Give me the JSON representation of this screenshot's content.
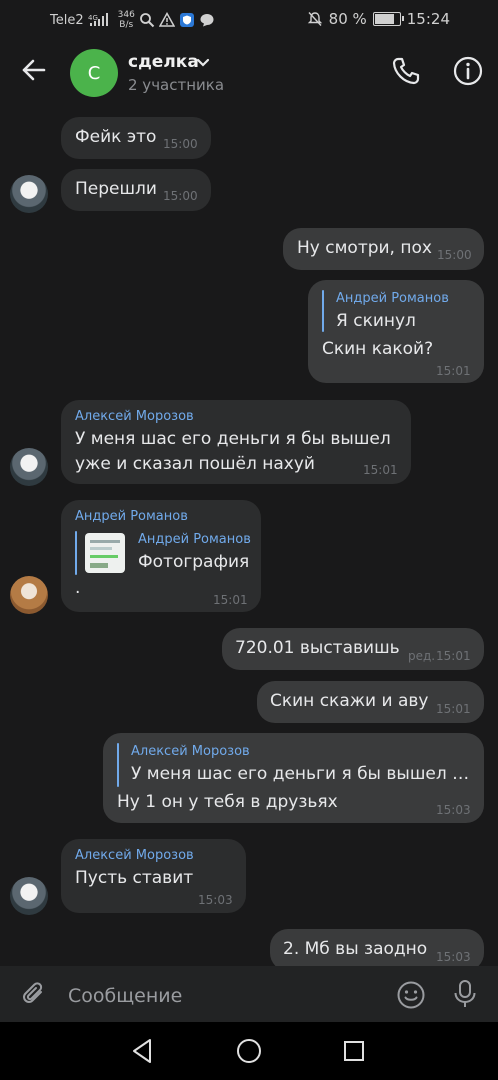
{
  "status_bar": {
    "carrier": "Tele2",
    "network": "4G",
    "speed_value": "346",
    "speed_unit": "B/s",
    "battery": "80 %",
    "battery_level": 0.8,
    "time": "15:24"
  },
  "header": {
    "avatar_letter": "С",
    "title": "сделка",
    "subtitle": "2 участника"
  },
  "messages": [
    {
      "text": "Фейк это",
      "time": "15:00"
    },
    {
      "text": "Перешли",
      "time": "15:00"
    },
    {
      "text": "Ну смотри, пох",
      "time": "15:00"
    },
    {
      "reply_name": "Андрей Романов",
      "reply_text": "Я скинул",
      "text": "Скин какой?",
      "time": "15:01"
    },
    {
      "sender": "Алексей Морозов",
      "line1": "У меня шас его деньги я бы вышел",
      "line2": "уже и сказал пошёл нахуй",
      "time": "15:01"
    },
    {
      "sender": "Андрей Романов",
      "reply_name": "Андрей Романов",
      "reply_text": "Фотография",
      "text": ".",
      "time": "15:01"
    },
    {
      "text": "720.01 выставишь",
      "edited": "ред.",
      "time": "15:01"
    },
    {
      "text": "Скин скажи и аву",
      "time": "15:01"
    },
    {
      "reply_name": "Алексей Морозов",
      "reply_text": "У меня шас его деньги я бы вышел уже и сказал пошёл нахуй",
      "text": "Ну 1 он у тебя в друзьях",
      "time": "15:03"
    },
    {
      "sender": "Алексей Морозов",
      "text": "Пусть ставит",
      "time": "15:03"
    },
    {
      "text": "2. Мб вы заодно",
      "time": "15:03"
    }
  ],
  "composer": {
    "placeholder": "Сообщение"
  },
  "icons": {
    "back": "arrow-left-icon",
    "call": "phone-icon",
    "info": "info-icon",
    "attach": "paperclip-icon",
    "emoji": "smile-icon",
    "voice": "microphone-icon"
  },
  "colors": {
    "background": "#19191a",
    "bubble_in": "#2c2d2e",
    "bubble_out": "#3a3b3c",
    "accent": "#71aaeb",
    "avatar_green": "#4bb34b"
  }
}
